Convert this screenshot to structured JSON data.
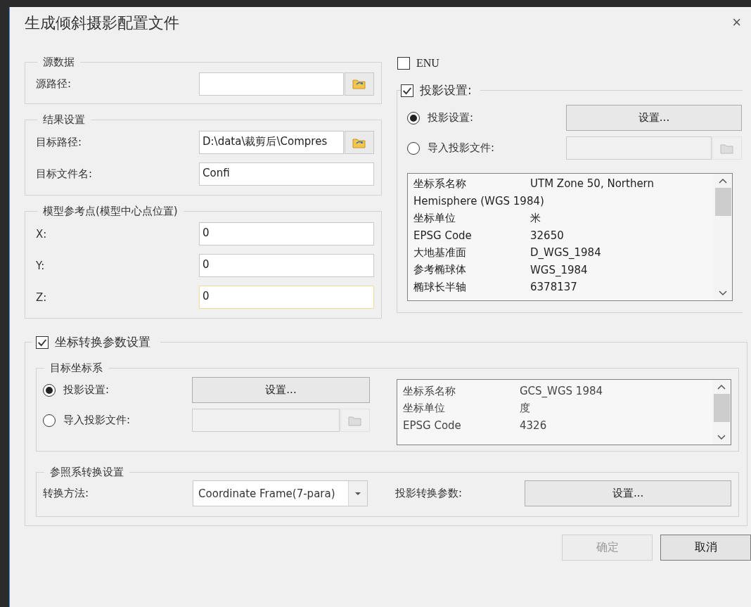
{
  "window": {
    "title": "生成倾斜摄影配置文件",
    "close": "×"
  },
  "source": {
    "title": "源数据",
    "fields": [
      {
        "label": "源路径:",
        "kind": "browse",
        "focused": false
      }
    ]
  },
  "result": {
    "title": "结果设置",
    "fields": [
      {
        "label": "目标路径:",
        "value": "D:\\data\\裁剪后\\Compres",
        "kind": "browse",
        "focused": false
      },
      {
        "label": "目标文件名:",
        "value": "Confi",
        "kind": "plain",
        "focused": false
      }
    ]
  },
  "reference_point": {
    "title": "模型参考点(模型中心点位置)",
    "fields": [
      {
        "label": "X:",
        "value": "0",
        "kind": "plain",
        "focused": false
      },
      {
        "label": "Y:",
        "value": "0",
        "kind": "plain",
        "focused": false
      },
      {
        "label": "Z:",
        "value": "0",
        "kind": "plain",
        "focused": true
      }
    ]
  },
  "enu": {
    "label": "ENU",
    "checked": false
  },
  "projection": {
    "label": "投影设置:",
    "checked": true,
    "options": [
      {
        "label": "投影设置:",
        "selected": true,
        "kind": "button",
        "button": "设置..."
      },
      {
        "label": "导入投影文件:",
        "selected": false,
        "kind": "file"
      }
    ],
    "info": [
      {
        "kind": "pair",
        "key": "坐标系名称",
        "value": "UTM Zone 50, Northern"
      },
      {
        "kind": "wrap",
        "text": "Hemisphere (WGS 1984)"
      },
      {
        "kind": "pair",
        "key": "坐标单位",
        "value": "米"
      },
      {
        "kind": "pair",
        "key": "EPSG Code",
        "value": "32650"
      },
      {
        "kind": "pair",
        "key": "大地基准面",
        "value": "D_WGS_1984"
      },
      {
        "kind": "pair",
        "key": "参考椭球体",
        "value": "WGS_1984"
      },
      {
        "kind": "pair",
        "key": "椭球长半轴",
        "value": "6378137"
      }
    ]
  },
  "transform": {
    "label": "坐标转换参数设置",
    "checked": true,
    "target": {
      "title": "目标坐标系",
      "options": [
        {
          "label": "投影设置:",
          "selected": true,
          "kind": "button",
          "button": "设置..."
        },
        {
          "label": "导入投影文件:",
          "selected": false,
          "kind": "file"
        }
      ],
      "info": [
        {
          "kind": "pair",
          "key": "坐标系名称",
          "value": "GCS_WGS 1984"
        },
        {
          "kind": "pair",
          "key": "坐标单位",
          "value": "度"
        },
        {
          "kind": "pair",
          "key": "EPSG Code",
          "value": "4326"
        }
      ]
    },
    "reference": {
      "title": "参照系转换设置",
      "method_label": "转换方法:",
      "method": "Coordinate Frame(7-para)",
      "params_label": "投影转换参数:",
      "params_button": "设置..."
    }
  },
  "buttons": [
    {
      "label": "确定",
      "disabled": true
    },
    {
      "label": "取消",
      "disabled": false
    }
  ]
}
